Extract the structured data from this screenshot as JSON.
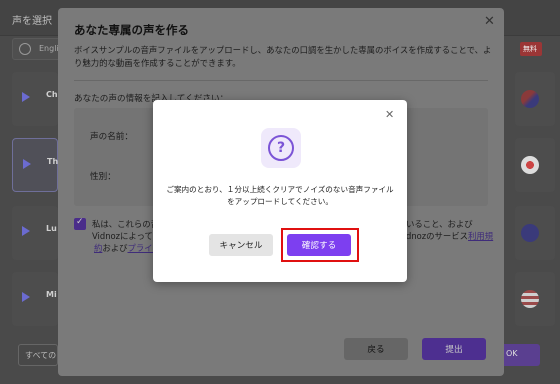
{
  "background": {
    "title": "声を選択",
    "language": "Englis",
    "voices_left": [
      "Ch",
      "Th",
      "Lu",
      "Mi"
    ],
    "bottom_left_label": "すべての",
    "ok_label": "OK",
    "tag_label": "無料"
  },
  "main_dialog": {
    "title": "あなた専属の声を作る",
    "description": "ボイスサンプルの音声ファイルをアップロードし、あなたの口調を生かした専属のボイスを作成することで、より魅力的な動画を作成することができます。",
    "section_title": "あなたの声の情報を記入してください：",
    "name_label": "声の名前：",
    "gender_label": "性別：",
    "agree_line1": "私は、これらの音",
    "agree_line2": "Vidnozによって",
    "agree_line3_prefix": "約",
    "agree_line3_and": "および",
    "agree_line3_link": "プライバ",
    "agree_right1": "いること、および",
    "agree_right2_prefix": "dnozのサービス",
    "agree_right2_link": "利用規",
    "back_label": "戻る",
    "submit_label": "提出"
  },
  "confirm_modal": {
    "icon": "question-icon",
    "message": "ご案内のとおり、１分以上続くクリアでノイズのない音声ファイルをアップロードしてください。",
    "cancel_label": "キャンセル",
    "confirm_label": "確認する",
    "accent_color": "#7d3ff0",
    "highlight_color": "#e01010"
  }
}
